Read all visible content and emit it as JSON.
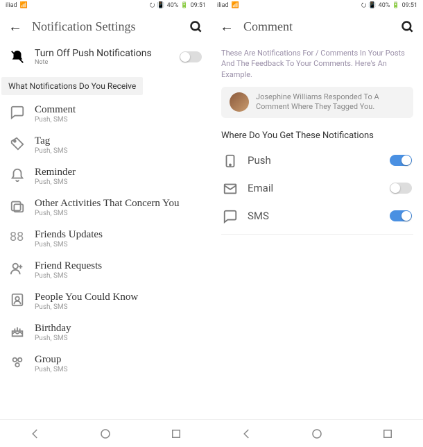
{
  "status": {
    "carrier": "iliad",
    "battery": "40%",
    "time": "09:51"
  },
  "left": {
    "title": "Notification Settings",
    "pushOff": {
      "title": "Turn Off Push Notifications",
      "note": "Note"
    },
    "sectionLabel": "What Notifications Do You Receive",
    "items": [
      {
        "title": "Comment",
        "sub": "Push, SMS"
      },
      {
        "title": "Tag",
        "sub": "Push, SMS"
      },
      {
        "title": "Reminder",
        "sub": "Push, SMS"
      },
      {
        "title": "Other Activities That Concern You",
        "sub": "Push, SMS"
      },
      {
        "title": "Friends Updates",
        "sub": "Push, SMS"
      },
      {
        "title": "Friend Requests",
        "sub": "Push, SMS"
      },
      {
        "title": "People You Could Know",
        "sub": "Push, SMS"
      },
      {
        "title": "Birthday",
        "sub": "Push, SMS"
      },
      {
        "title": "Group",
        "sub": "Push, SMS"
      }
    ]
  },
  "right": {
    "title": "Comment",
    "desc": "These Are Notifications For / Comments In Your Posts And The Feedback To Your Comments. Here's An Example.",
    "example": "Josephine Williams Responded To A Comment Where They Tagged You.",
    "sectionLabel": "Where Do You Get These Notifications",
    "channels": [
      {
        "label": "Push",
        "on": true
      },
      {
        "label": "Email",
        "on": false
      },
      {
        "label": "SMS",
        "on": true
      }
    ]
  }
}
